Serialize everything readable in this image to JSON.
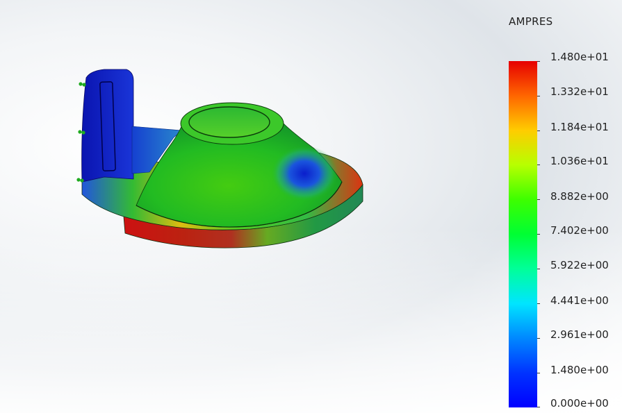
{
  "legend": {
    "title": "AMPRES",
    "labels": [
      "1.480e+01",
      "1.332e+01",
      "1.184e+01",
      "1.036e+01",
      "8.882e+00",
      "7.402e+00",
      "5.922e+00",
      "4.441e+00",
      "2.961e+00",
      "1.480e+00",
      "0.000e+00"
    ],
    "max": 14.8,
    "min": 0,
    "colors": {
      "max": "#e60000",
      "mid": "#00ff33",
      "min": "#0000ff"
    }
  },
  "model": {
    "description_icon": "cad-part-with-cone-and-bracket"
  }
}
